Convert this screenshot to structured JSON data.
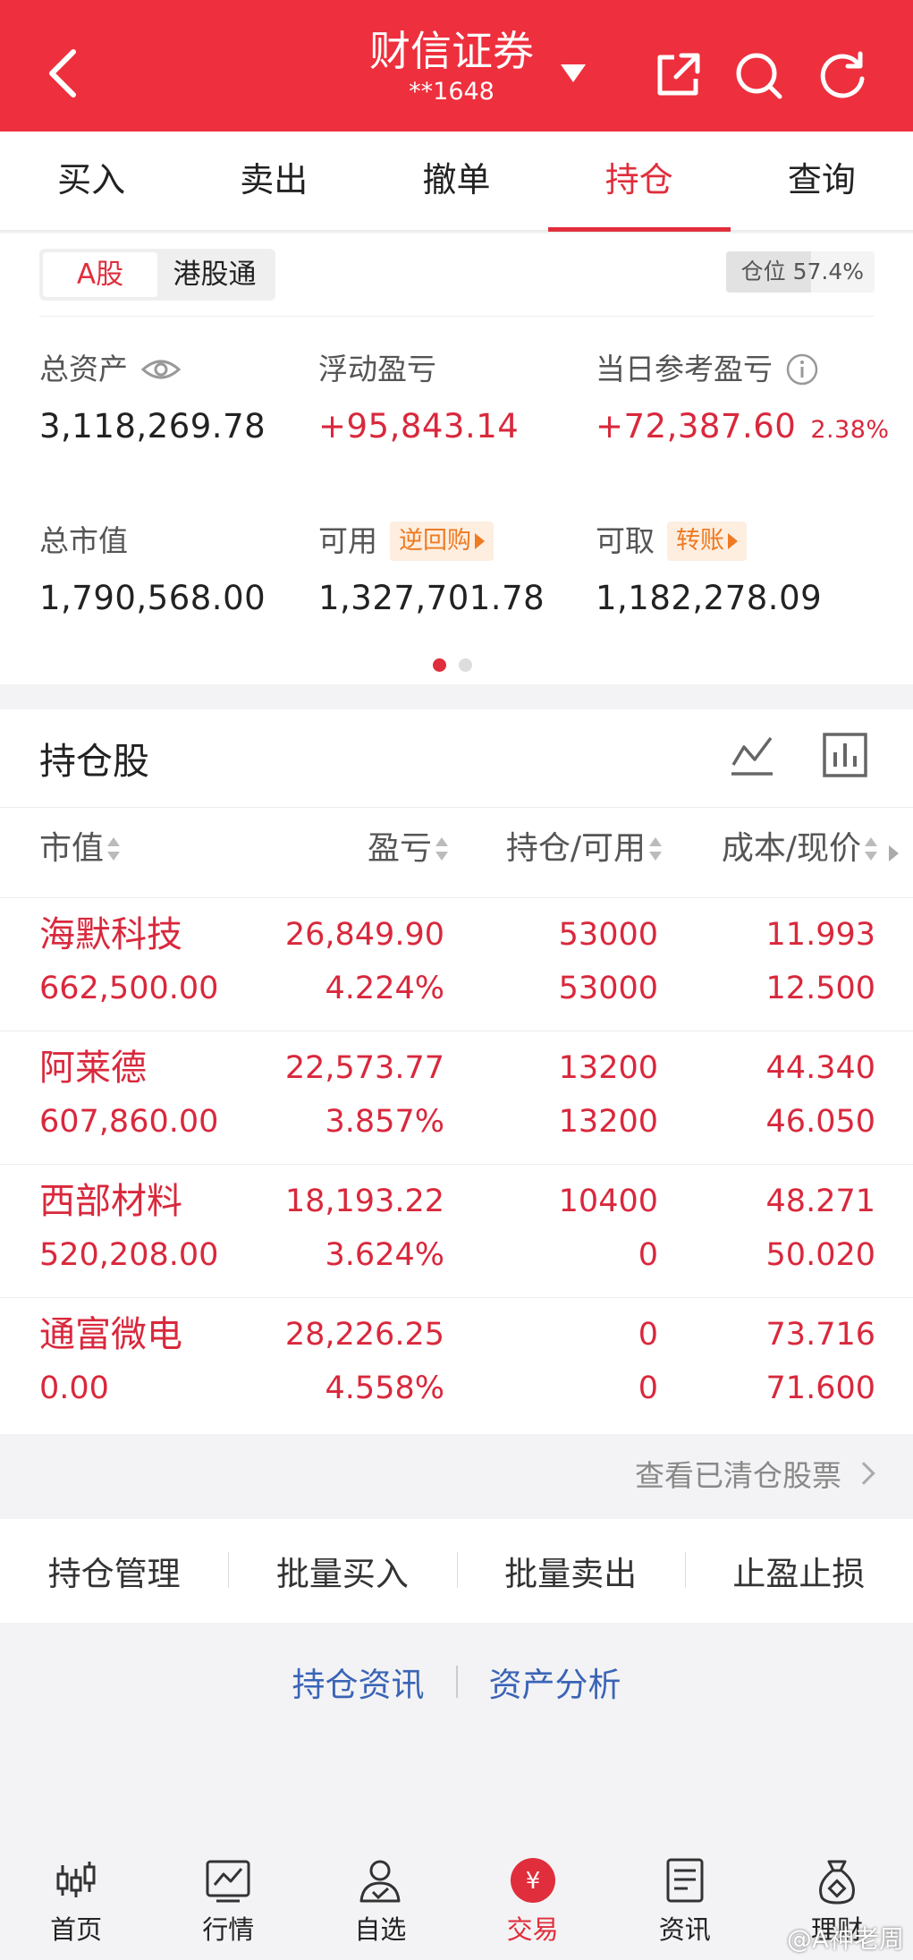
{
  "header": {
    "title": "财信证券",
    "account": "**1648",
    "background_color": "#ee2f3d"
  },
  "tabs": [
    {
      "label": "买入"
    },
    {
      "label": "卖出"
    },
    {
      "label": "撤单"
    },
    {
      "label": "持仓",
      "active": true
    },
    {
      "label": "查询"
    }
  ],
  "market_segment": {
    "options": [
      "A股",
      "港股通"
    ],
    "selected": "A股"
  },
  "position_ratio": {
    "label": "仓位",
    "value": "57.4%",
    "fraction": 0.574
  },
  "summary": {
    "total_assets": {
      "label": "总资产",
      "value": "3,118,269.78"
    },
    "floating_pl": {
      "label": "浮动盈亏",
      "value": "+95,843.14"
    },
    "daily_pl": {
      "label": "当日参考盈亏",
      "value": "+72,387.60",
      "percent": "2.38%"
    },
    "market_value": {
      "label": "总市值",
      "value": "1,790,568.00"
    },
    "available": {
      "label": "可用",
      "tag": "逆回购",
      "value": "1,327,701.78"
    },
    "withdrawable": {
      "label": "可取",
      "tag": "转账",
      "value": "1,182,278.09"
    }
  },
  "holdings": {
    "title": "持仓股",
    "columns": [
      "市值",
      "盈亏",
      "持仓/可用",
      "成本/现价"
    ],
    "rows": [
      {
        "name": "海默科技",
        "market_value": "662,500.00",
        "pl": "26,849.90",
        "pl_pct": "4.224%",
        "position": "53000",
        "available": "53000",
        "cost": "11.993",
        "price": "12.500"
      },
      {
        "name": "阿莱德",
        "market_value": "607,860.00",
        "pl": "22,573.77",
        "pl_pct": "3.857%",
        "position": "13200",
        "available": "13200",
        "cost": "44.340",
        "price": "46.050"
      },
      {
        "name": "西部材料",
        "market_value": "520,208.00",
        "pl": "18,193.22",
        "pl_pct": "3.624%",
        "position": "10400",
        "available": "0",
        "cost": "48.271",
        "price": "50.020"
      },
      {
        "name": "通富微电",
        "market_value": "0.00",
        "pl": "28,226.25",
        "pl_pct": "4.558%",
        "position": "0",
        "available": "0",
        "cost": "73.716",
        "price": "71.600"
      }
    ],
    "cleared_link": "查看已清仓股票"
  },
  "actions": [
    "持仓管理",
    "批量买入",
    "批量卖出",
    "止盈止损"
  ],
  "links": [
    "持仓资讯",
    "资产分析"
  ],
  "bottom_nav": [
    {
      "label": "首页",
      "icon": "candlestick-icon"
    },
    {
      "label": "行情",
      "icon": "chart-icon"
    },
    {
      "label": "自选",
      "icon": "user-check-icon"
    },
    {
      "label": "交易",
      "icon": "yuan-icon",
      "active": true
    },
    {
      "label": "资讯",
      "icon": "news-icon"
    },
    {
      "label": "理财",
      "icon": "money-bag-icon"
    }
  ],
  "watermark": "@A神老周",
  "colors": {
    "accent": "#e02e3c",
    "profit": "#d9283c",
    "link": "#3a64b6",
    "tag": "#ef7a22"
  }
}
